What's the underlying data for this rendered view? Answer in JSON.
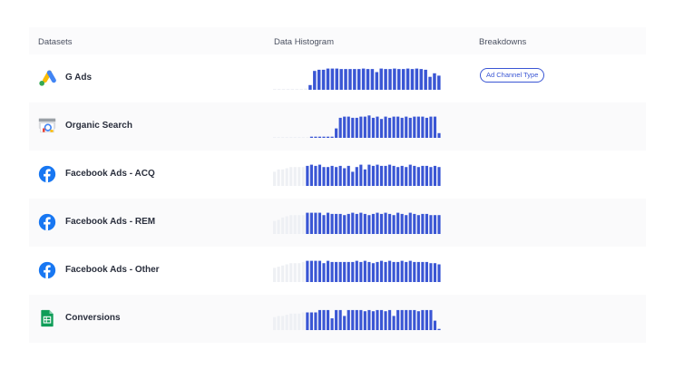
{
  "header": {
    "datasets": "Datasets",
    "histogram": "Data Histogram",
    "breakdowns": "Breakdowns"
  },
  "colors": {
    "bar": "#3a56d4",
    "bar_faded": "#eef0f4",
    "row_alt": "#fafafb"
  },
  "rows": [
    {
      "name": "G Ads",
      "icon": "google-ads-icon",
      "breakdown": "Ad Channel Type",
      "histogram": [
        0.02,
        0.02,
        0.02,
        0.02,
        0.02,
        0.02,
        0.02,
        0.05,
        0.2,
        0.8,
        0.85,
        0.85,
        0.9,
        0.9,
        0.9,
        0.88,
        0.88,
        0.88,
        0.88,
        0.88,
        0.9,
        0.88,
        0.88,
        0.75,
        0.9,
        0.88,
        0.88,
        0.9,
        0.88,
        0.88,
        0.9,
        0.88,
        0.9,
        0.88,
        0.85,
        0.55,
        0.7,
        0.6
      ]
    },
    {
      "name": "Organic Search",
      "icon": "google-search-console-icon",
      "breakdown": "",
      "histogram": [
        0.0,
        0.0,
        0.0,
        0.0,
        0.0,
        0.0,
        0.0,
        0.0,
        0.0,
        0.05,
        0.05,
        0.05,
        0.05,
        0.05,
        0.05,
        0.4,
        0.85,
        0.9,
        0.9,
        0.85,
        0.85,
        0.9,
        0.9,
        0.95,
        0.85,
        0.9,
        0.8,
        0.9,
        0.85,
        0.9,
        0.9,
        0.85,
        0.9,
        0.85,
        0.9,
        0.9,
        0.9,
        0.85,
        0.9,
        0.9,
        0.2
      ]
    },
    {
      "name": "Facebook Ads - ACQ",
      "icon": "facebook-icon",
      "breakdown": "",
      "histogram": [
        0.6,
        0.7,
        0.7,
        0.75,
        0.8,
        0.8,
        0.8,
        0.8,
        0.85,
        0.9,
        0.85,
        0.9,
        0.8,
        0.8,
        0.85,
        0.8,
        0.85,
        0.75,
        0.85,
        0.6,
        0.8,
        0.9,
        0.7,
        0.9,
        0.85,
        0.9,
        0.85,
        0.85,
        0.9,
        0.85,
        0.8,
        0.85,
        0.8,
        0.9,
        0.85,
        0.8,
        0.85,
        0.85,
        0.8,
        0.85,
        0.8
      ]
    },
    {
      "name": "Facebook Ads - REM",
      "icon": "facebook-icon",
      "breakdown": "",
      "histogram": [
        0.55,
        0.6,
        0.7,
        0.75,
        0.8,
        0.8,
        0.8,
        0.8,
        0.9,
        0.9,
        0.9,
        0.9,
        0.8,
        0.9,
        0.85,
        0.85,
        0.85,
        0.8,
        0.85,
        0.9,
        0.85,
        0.9,
        0.85,
        0.8,
        0.85,
        0.9,
        0.85,
        0.9,
        0.85,
        0.8,
        0.9,
        0.85,
        0.8,
        0.9,
        0.85,
        0.8,
        0.85,
        0.85,
        0.8,
        0.8,
        0.8
      ]
    },
    {
      "name": "Facebook Ads - Other",
      "icon": "facebook-icon",
      "breakdown": "",
      "histogram": [
        0.6,
        0.65,
        0.7,
        0.75,
        0.8,
        0.8,
        0.8,
        0.85,
        0.9,
        0.9,
        0.9,
        0.9,
        0.8,
        0.9,
        0.85,
        0.85,
        0.85,
        0.85,
        0.85,
        0.85,
        0.9,
        0.85,
        0.9,
        0.85,
        0.8,
        0.85,
        0.9,
        0.85,
        0.9,
        0.85,
        0.85,
        0.9,
        0.85,
        0.9,
        0.85,
        0.85,
        0.85,
        0.85,
        0.8,
        0.8,
        0.75
      ]
    },
    {
      "name": "Conversions",
      "icon": "google-sheets-icon",
      "breakdown": "",
      "histogram": [
        0.55,
        0.6,
        0.6,
        0.65,
        0.7,
        0.7,
        0.7,
        0.75,
        0.75,
        0.75,
        0.75,
        0.85,
        0.85,
        0.85,
        0.5,
        0.85,
        0.85,
        0.6,
        0.85,
        0.85,
        0.85,
        0.85,
        0.8,
        0.85,
        0.8,
        0.85,
        0.85,
        0.8,
        0.85,
        0.6,
        0.85,
        0.85,
        0.85,
        0.85,
        0.85,
        0.8,
        0.85,
        0.85,
        0.85,
        0.4,
        0.05
      ]
    }
  ]
}
